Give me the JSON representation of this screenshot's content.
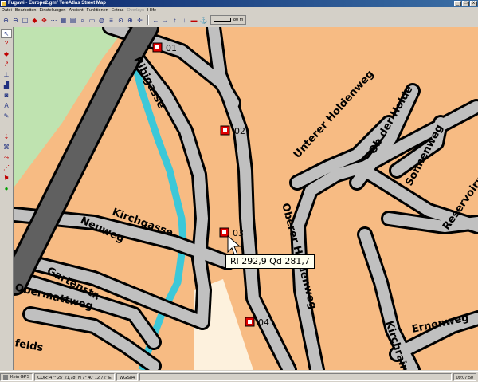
{
  "window": {
    "title": "Fugawi - Europe2.gmf  TeleAtlas Street Map",
    "controls": [
      "_",
      "□",
      "x"
    ]
  },
  "menu": [
    {
      "label": "Datei",
      "enabled": true
    },
    {
      "label": "Bearbeiten",
      "enabled": true
    },
    {
      "label": "Einstellungen",
      "enabled": true
    },
    {
      "label": "Ansicht",
      "enabled": true
    },
    {
      "label": "Funktionen",
      "enabled": true
    },
    {
      "label": "Extras",
      "enabled": true
    },
    {
      "label": "Overlays",
      "enabled": false
    },
    {
      "label": "Hilfe",
      "enabled": true
    }
  ],
  "toolbar": {
    "scale_label": "80 m"
  },
  "map": {
    "streets": [
      "Ribigasse",
      "Kirchgasse",
      "Neuweg",
      "Gartenstr.",
      "Obermattweg",
      "Unterer Holdenweg",
      "Ob der Holde",
      "Sonnenweg",
      "Oberer Holdenweg",
      "Reservoirweg",
      "Ernenweg",
      "Kirchrain",
      "felds"
    ],
    "waypoints": [
      "01",
      "02",
      "03",
      "04"
    ],
    "colors": {
      "land": "#f7bb83",
      "road_fill": "#c0c0c0",
      "road_outline": "#000000",
      "highway": "#606060",
      "water": "#3cc8d8",
      "park": "#bfe3b0",
      "plain": "#fdf1dd",
      "waypoint": "#e00000"
    }
  },
  "tooltip": {
    "text": "Rl 292,9  Qd 281,7"
  },
  "status": {
    "gps": "Kein GPS",
    "cursor": "CUR: 47° 25' 21,78\" N 7° 40' 12,72\" E",
    "datum": "WGS84",
    "time": "09:07:50"
  }
}
